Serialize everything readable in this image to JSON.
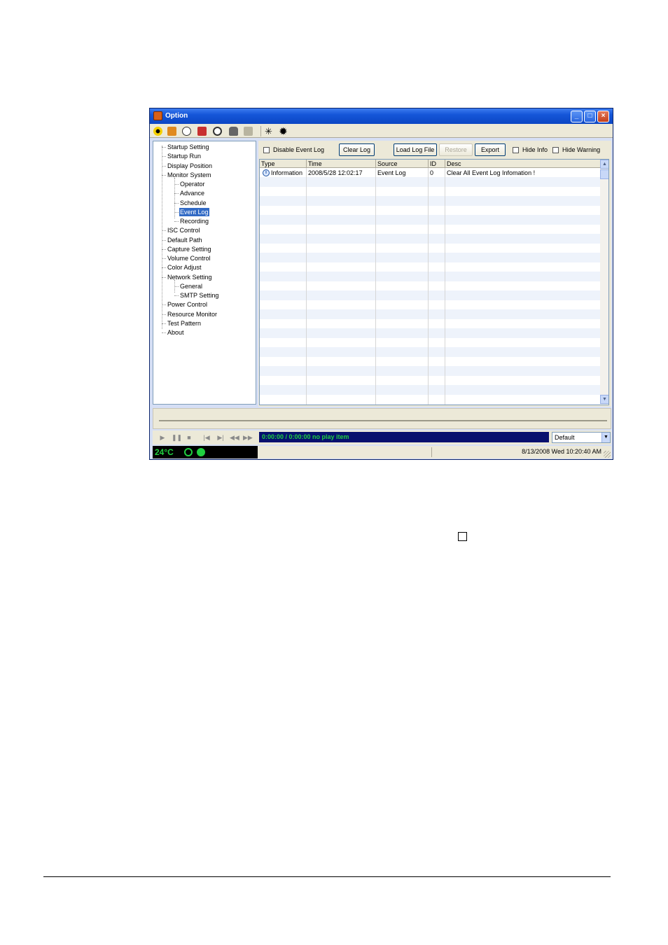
{
  "window": {
    "title": "Option",
    "controls": [
      "minimize",
      "maximize",
      "close"
    ]
  },
  "toolbar": {
    "icons": [
      "radiation-icon",
      "camera-icon",
      "gear-icon",
      "record-icon",
      "clock-icon",
      "hand-icon",
      "folder-icon",
      "star-burst-icon",
      "star-burst-dark-icon"
    ]
  },
  "tree": {
    "items": [
      {
        "label": "Startup Setting",
        "level": 0
      },
      {
        "label": "Startup Run",
        "level": 0
      },
      {
        "label": "Display Position",
        "level": 0
      },
      {
        "label": "Monitor System",
        "level": 0
      },
      {
        "label": "Operator",
        "level": 1
      },
      {
        "label": "Advance",
        "level": 1
      },
      {
        "label": "Schedule",
        "level": 1
      },
      {
        "label": "Event Log",
        "level": 1,
        "selected": true
      },
      {
        "label": "Recording",
        "level": 1
      },
      {
        "label": "ISC Control",
        "level": 0
      },
      {
        "label": "Default Path",
        "level": 0
      },
      {
        "label": "Capture Setting",
        "level": 0
      },
      {
        "label": "Volume Control",
        "level": 0
      },
      {
        "label": "Color Adjust",
        "level": 0
      },
      {
        "label": "Network Setting",
        "level": 0
      },
      {
        "label": "General",
        "level": 1
      },
      {
        "label": "SMTP Setting",
        "level": 1
      },
      {
        "label": "Power Control",
        "level": 0
      },
      {
        "label": "Resource Monitor",
        "level": 0
      },
      {
        "label": "Test Pattern",
        "level": 0
      },
      {
        "label": "About",
        "level": 0
      }
    ]
  },
  "eventlog": {
    "disable_label": "Disable Event Log",
    "clear_button": "Clear Log",
    "load_button": "Load Log File",
    "restore_button": "Restore",
    "export_button": "Export",
    "hide_info_label": "Hide Info",
    "hide_warning_label": "Hide Warning",
    "columns": [
      "Type",
      "Time",
      "Source",
      "ID",
      "Desc"
    ],
    "rows": [
      {
        "type": "Information",
        "time": "2008/5/28 12:02:17",
        "source": "Event Log",
        "id": "0",
        "desc": "Clear All Event Log Infomation !"
      }
    ]
  },
  "player": {
    "status": "0:00:00 / 0:00:00  no play item",
    "preset": "Default"
  },
  "statusbar": {
    "temperature": "24°C",
    "datetime": "8/13/2008 Wed 10:20:40 AM"
  },
  "colors": {
    "title_blue": "#0b46c4",
    "selection": "#316ac5",
    "status_green": "#20d040",
    "status_bg": "#07106e"
  }
}
